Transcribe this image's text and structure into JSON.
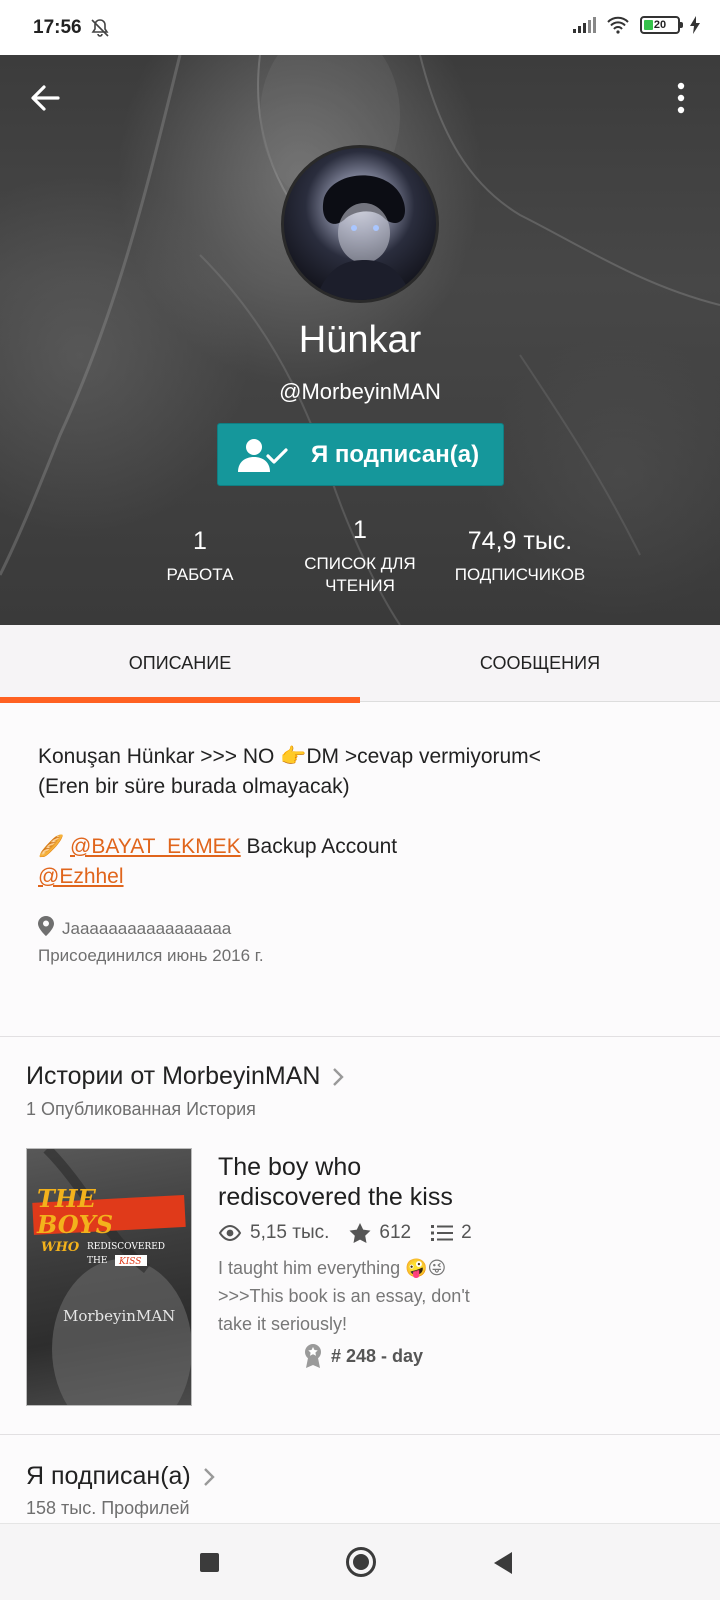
{
  "status_bar": {
    "time": "17:56",
    "battery": "20"
  },
  "profile": {
    "display_name": "Hünkar",
    "username": "@MorbeyinMAN",
    "follow_button_label": "Я подписан(а)"
  },
  "stats": [
    {
      "value": "1",
      "label": "РАБОТА"
    },
    {
      "value": "1",
      "label_line1": "СПИСОК ДЛЯ",
      "label_line2": "ЧТЕНИЯ"
    },
    {
      "value": "74,9 тыс.",
      "label": "ПОДПИСЧИКОВ"
    }
  ],
  "tabs": {
    "about": "ОПИСАНИЕ",
    "conversations": "СООБЩЕНИЯ",
    "active": "about"
  },
  "description": {
    "line1": "Konuşan Hünkar >>> NO 👉DM >cevap vermiyorum<",
    "line2": "(Eren bir süre burada olmayacak)",
    "line3_emoji": "🥖",
    "line3_link": "@BAYAT_EKMEK",
    "line3_text": " Backup Account",
    "line4_link": "@Ezhhel",
    "location": "Jaaaaaaaaaaaaaaaaa",
    "joined": "Присоединился июнь 2016 г."
  },
  "stories_section": {
    "title": "Истории от MorbeyinMAN",
    "subtitle": "1 Опубликованная История",
    "story": {
      "title_line1": "The boy who",
      "title_line2": "rediscovered the kiss",
      "reads": "5,15 тыс.",
      "votes": "612",
      "parts": "2",
      "desc_line1": "I taught him everything 🤪😜",
      "desc_line2": ">>>This book is an essay, don't",
      "desc_line3": "take it seriously!",
      "rank": "# 248 - day",
      "cover": {
        "line1": "THE",
        "line2": "BOYS",
        "line3_a": "WHO",
        "line3_b": "REDISCOVERED",
        "line4_a": "THE",
        "line4_b": "KISS",
        "author": "MorbeyinMAN"
      }
    }
  },
  "following_section": {
    "title": "Я подписан(а)",
    "subtitle": "158 тыс. Профилей"
  },
  "colors": {
    "accent": "#ff6122",
    "teal": "#15979b",
    "link": "#e0651c"
  }
}
